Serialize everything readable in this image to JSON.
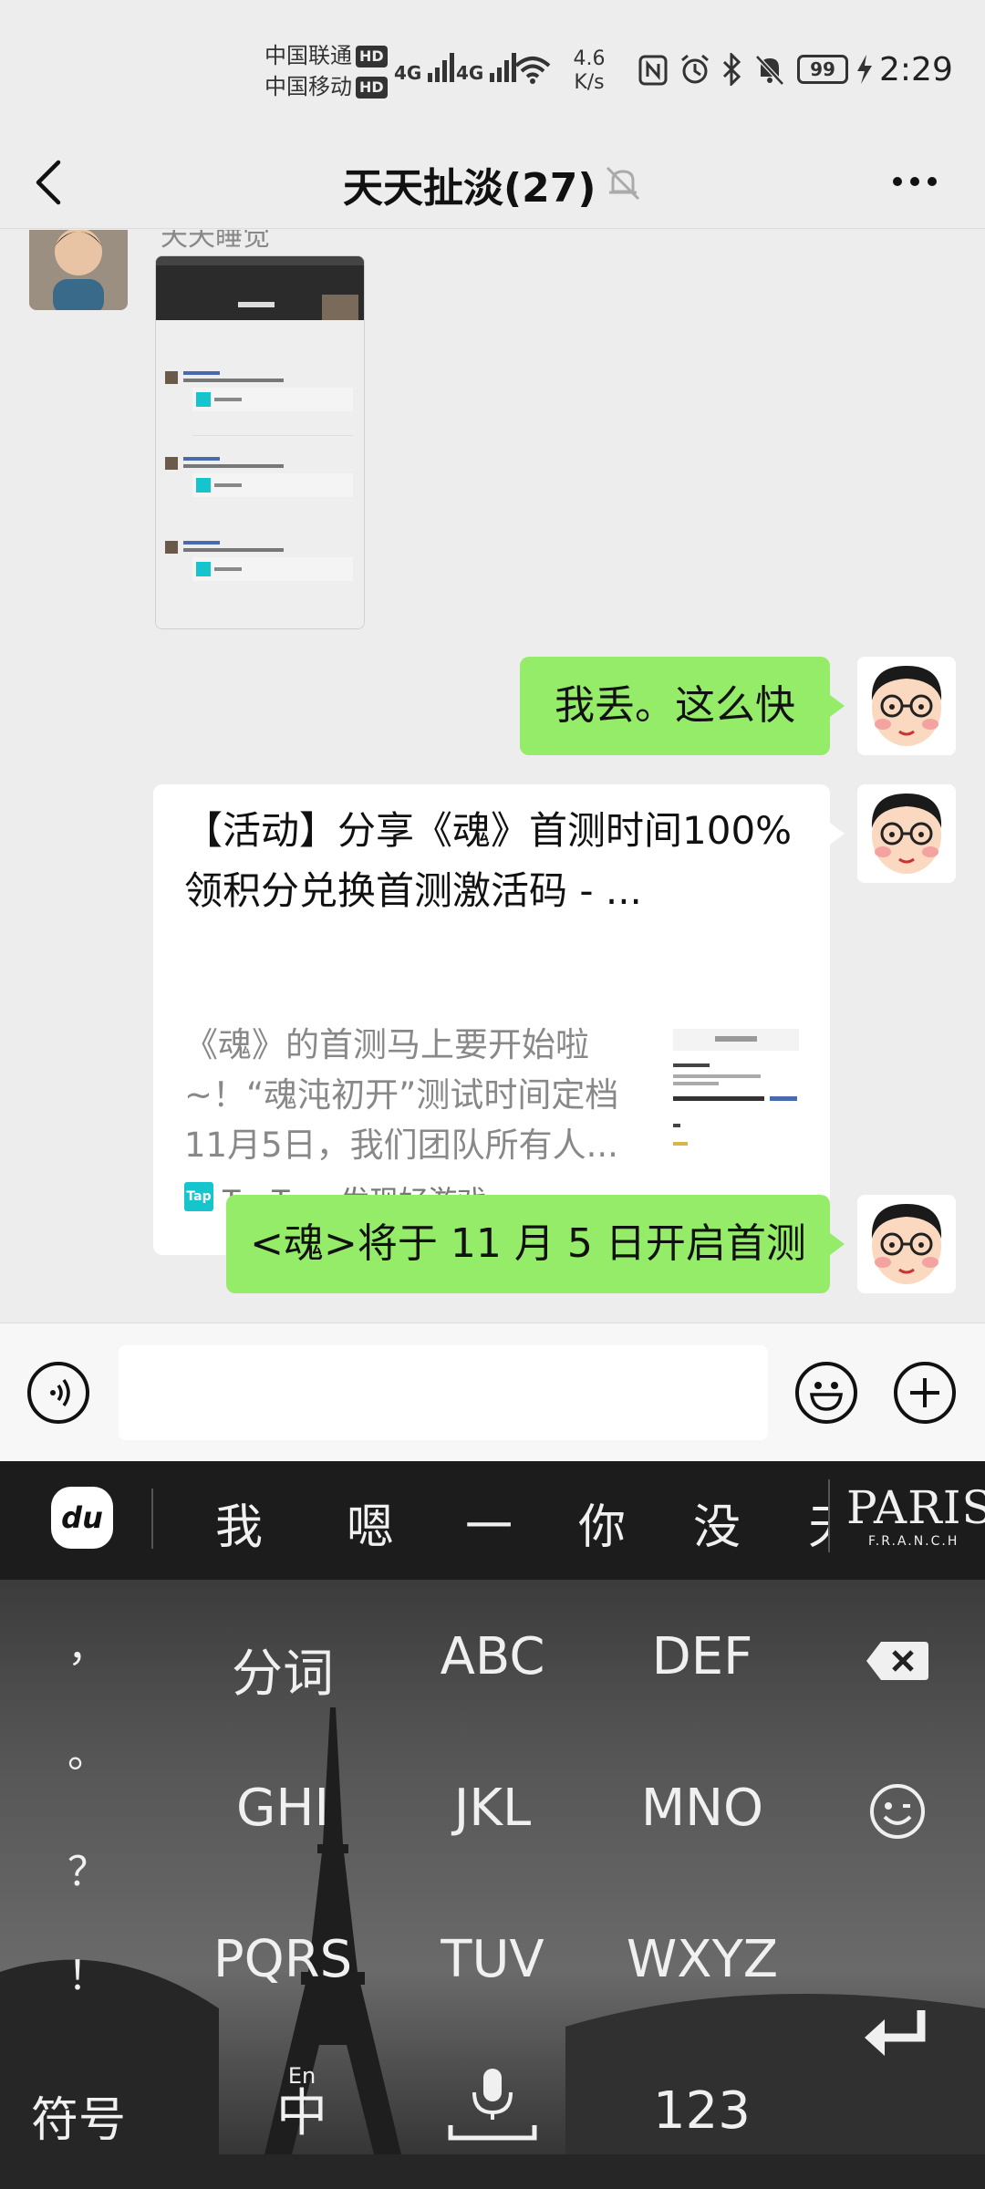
{
  "status_bar": {
    "carrier1": "中国联通",
    "carrier2": "中国移动",
    "hd": "HD",
    "net1": "4G",
    "net2": "4G",
    "speed_value": "4.6",
    "speed_unit": "K/s",
    "battery": "99",
    "time": "2:29"
  },
  "header": {
    "title": "天天扯淡(27)"
  },
  "messages": {
    "m1": {
      "sender_name": "天天睡觉"
    },
    "m2": {
      "text": "我丢。这么快"
    },
    "m3": {
      "title": "【活动】分享《魂》首测时间100%领积分兑换首测激活码 - ...",
      "desc": "《魂》的首测马上要开始啦~！“魂沌初开”测试时间定档11月5日，我们团队所有人...",
      "source_logo": "Tap",
      "source": "TapTap: 发现好游戏"
    },
    "m4": {
      "text": "<魂>将于 11 月 5 日开启首测"
    }
  },
  "keyboard": {
    "candidates": [
      "我",
      "嗯",
      "一",
      "你",
      "没",
      "天"
    ],
    "logo": "du",
    "skin_title": "PARIS",
    "skin_sub": "F.R.A.N.C.H",
    "rows": [
      [
        "分词",
        "ABC",
        "DEF"
      ],
      [
        "GHI",
        "JKL",
        "MNO"
      ],
      [
        "PQRS",
        "TUV",
        "WXYZ"
      ]
    ],
    "side_punct": [
      "，",
      "。",
      "？",
      "！"
    ],
    "symbol_key": "符号",
    "lang_key_top": "En",
    "lang_key": "中",
    "num_key": "123"
  },
  "colors": {
    "bubble_green": "#95ec69",
    "background": "#ededed",
    "taptap": "#15c5ce"
  }
}
